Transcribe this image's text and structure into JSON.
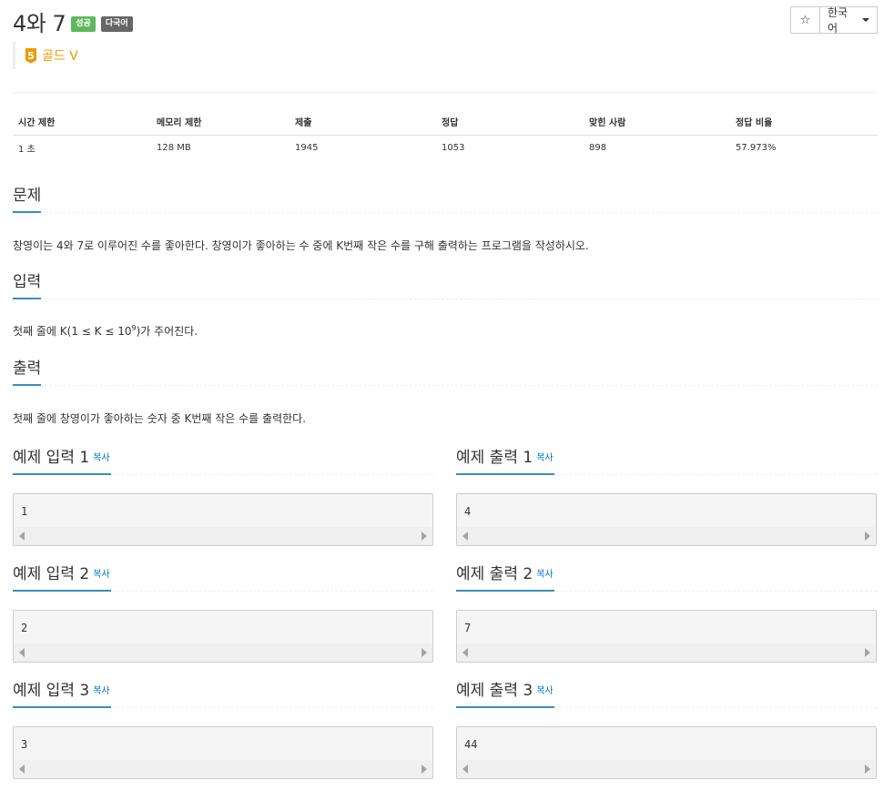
{
  "problem": {
    "title": "4와 7",
    "labels": [
      "성공",
      "다국어"
    ],
    "tier": "골드 V",
    "tier_number": "5"
  },
  "toolbar": {
    "star": "☆",
    "language": "한국어"
  },
  "info_table": {
    "headers": [
      "시간 제한",
      "메모리 제한",
      "제출",
      "정답",
      "맞힌 사람",
      "정답 비율"
    ],
    "values": [
      "1 초",
      "128 MB",
      "1945",
      "1053",
      "898",
      "57.973%"
    ]
  },
  "sections": {
    "problem_title": "문제",
    "problem_text": "창영이는 4와 7로 이루어진 수를 좋아한다. 창영이가 좋아하는 수 중에 K번째 작은 수를 구해 출력하는 프로그램을 작성하시오.",
    "input_title": "입력",
    "input_text_pre": "첫째 줄에 K(1 ≤ K ≤ 10",
    "input_text_sup": "9",
    "input_text_post": ")가 주어진다.",
    "output_title": "출력",
    "output_text": "첫째 줄에 창영이가 좋아하는 숫자 중 K번째 작은 수를 출력한다."
  },
  "samples": [
    {
      "input_title": "예제 입력 1",
      "output_title": "예제 출력 1",
      "input": "1",
      "output": "4"
    },
    {
      "input_title": "예제 입력 2",
      "output_title": "예제 출력 2",
      "input": "2",
      "output": "7"
    },
    {
      "input_title": "예제 입력 3",
      "output_title": "예제 출력 3",
      "input": "3",
      "output": "44"
    }
  ],
  "copy_label": "복사"
}
